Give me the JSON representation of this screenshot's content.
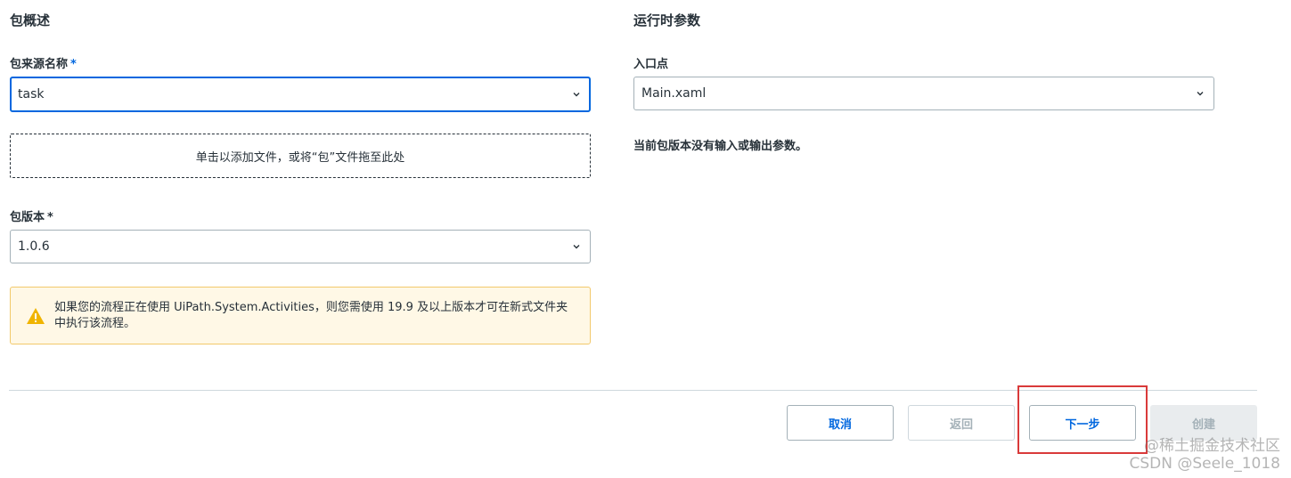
{
  "left": {
    "section_title": "包概述",
    "source_label": "包来源名称",
    "source_value": "task",
    "dropzone_text": "单击以添加文件，或将“包”文件拖至此处",
    "version_label": "包版本",
    "version_value": "1.0.6",
    "required_mark": "*",
    "alert_text": "如果您的流程正在使用 UiPath.System.Activities，则您需使用 19.9 及以上版本才可在新式文件夹中执行该流程。"
  },
  "right": {
    "section_title": "运行时参数",
    "entry_label": "入口点",
    "entry_value": "Main.xaml",
    "no_params_text": "当前包版本没有输入或输出参数。"
  },
  "footer": {
    "cancel_label": "取消",
    "back_label": "返回",
    "next_label": "下一步",
    "create_label": "创建"
  },
  "watermark": {
    "line1": "@稀土掘金技术社区",
    "line2": "CSDN @Seele_1018"
  },
  "colors": {
    "accent": "#0067df",
    "alert_bg": "#fff8e6",
    "alert_border": "#f2c96b",
    "warning_icon": "#f0b400",
    "highlight": "#d93a3a"
  },
  "icons": {
    "dropdown": "chevron-down-icon",
    "warning": "warning-triangle-icon"
  }
}
